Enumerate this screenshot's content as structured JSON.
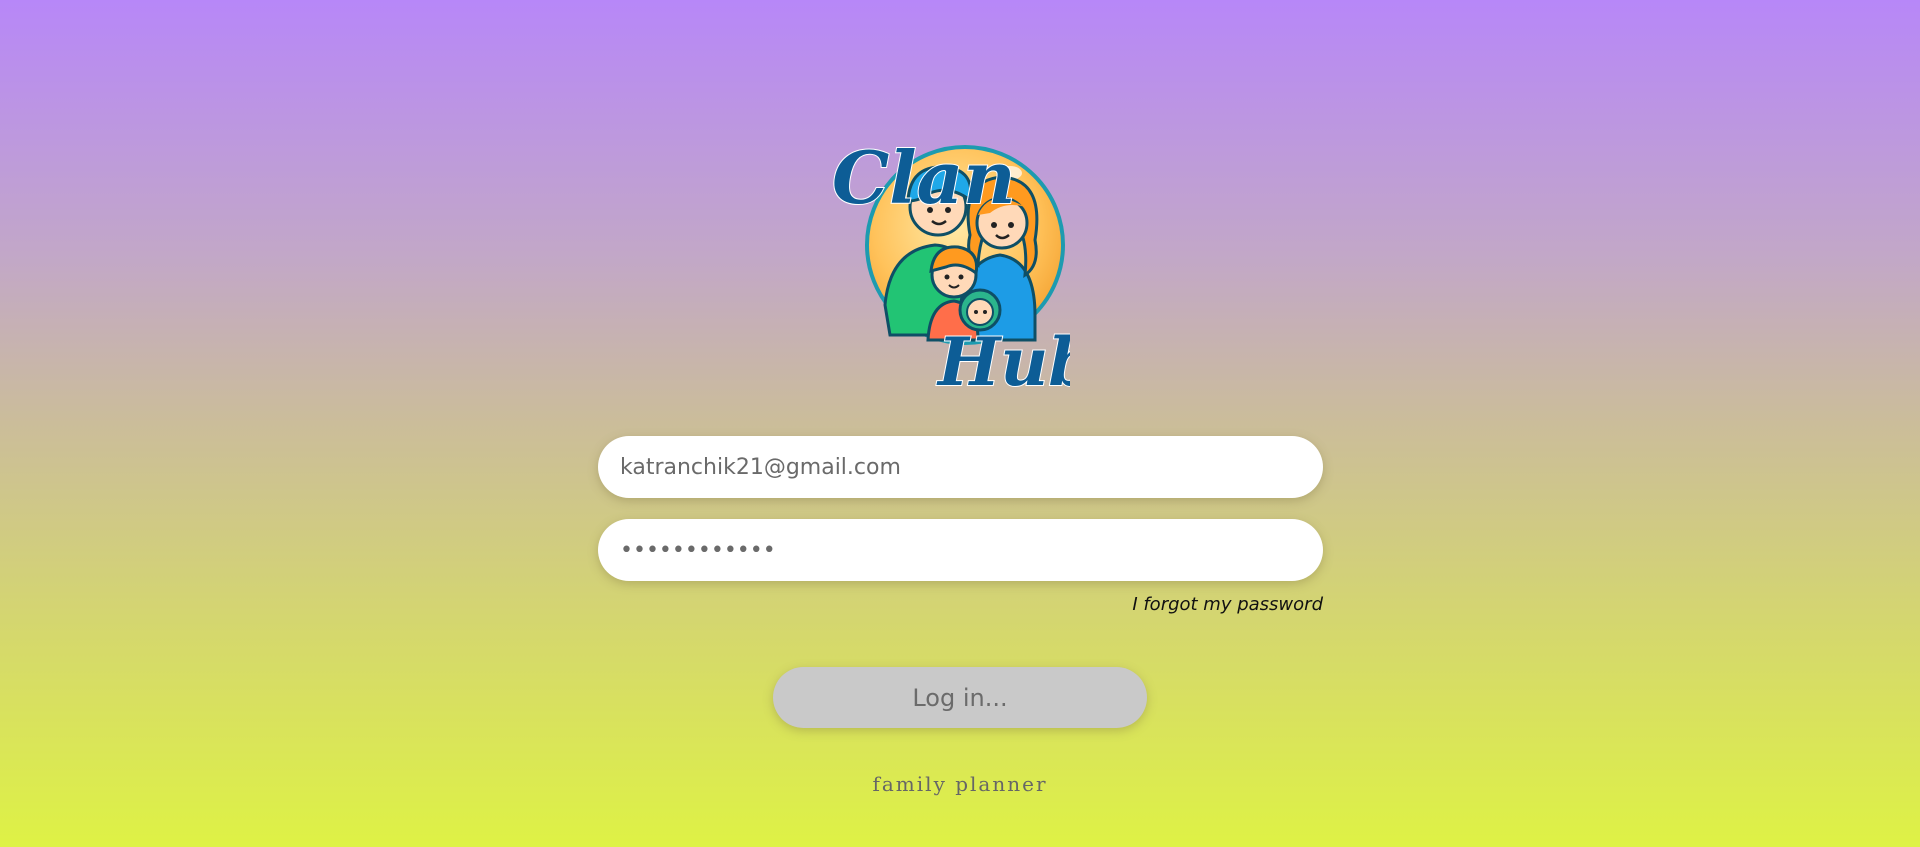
{
  "logo": {
    "word_top": "Clan",
    "word_bottom": "Hub"
  },
  "login": {
    "email_value": "katranchik21@gmail.com",
    "password_value": "••••••••••••",
    "forgot_label": "I forgot my password",
    "login_button_label": "Log in..."
  },
  "footer": {
    "tagline": "family planner"
  },
  "colors": {
    "background_top": "#b787f8",
    "background_bottom": "#def245",
    "button_bg": "#c9c9c9",
    "logo_text": "#0d5d96"
  },
  "icons": {
    "logo": "family-icon"
  }
}
